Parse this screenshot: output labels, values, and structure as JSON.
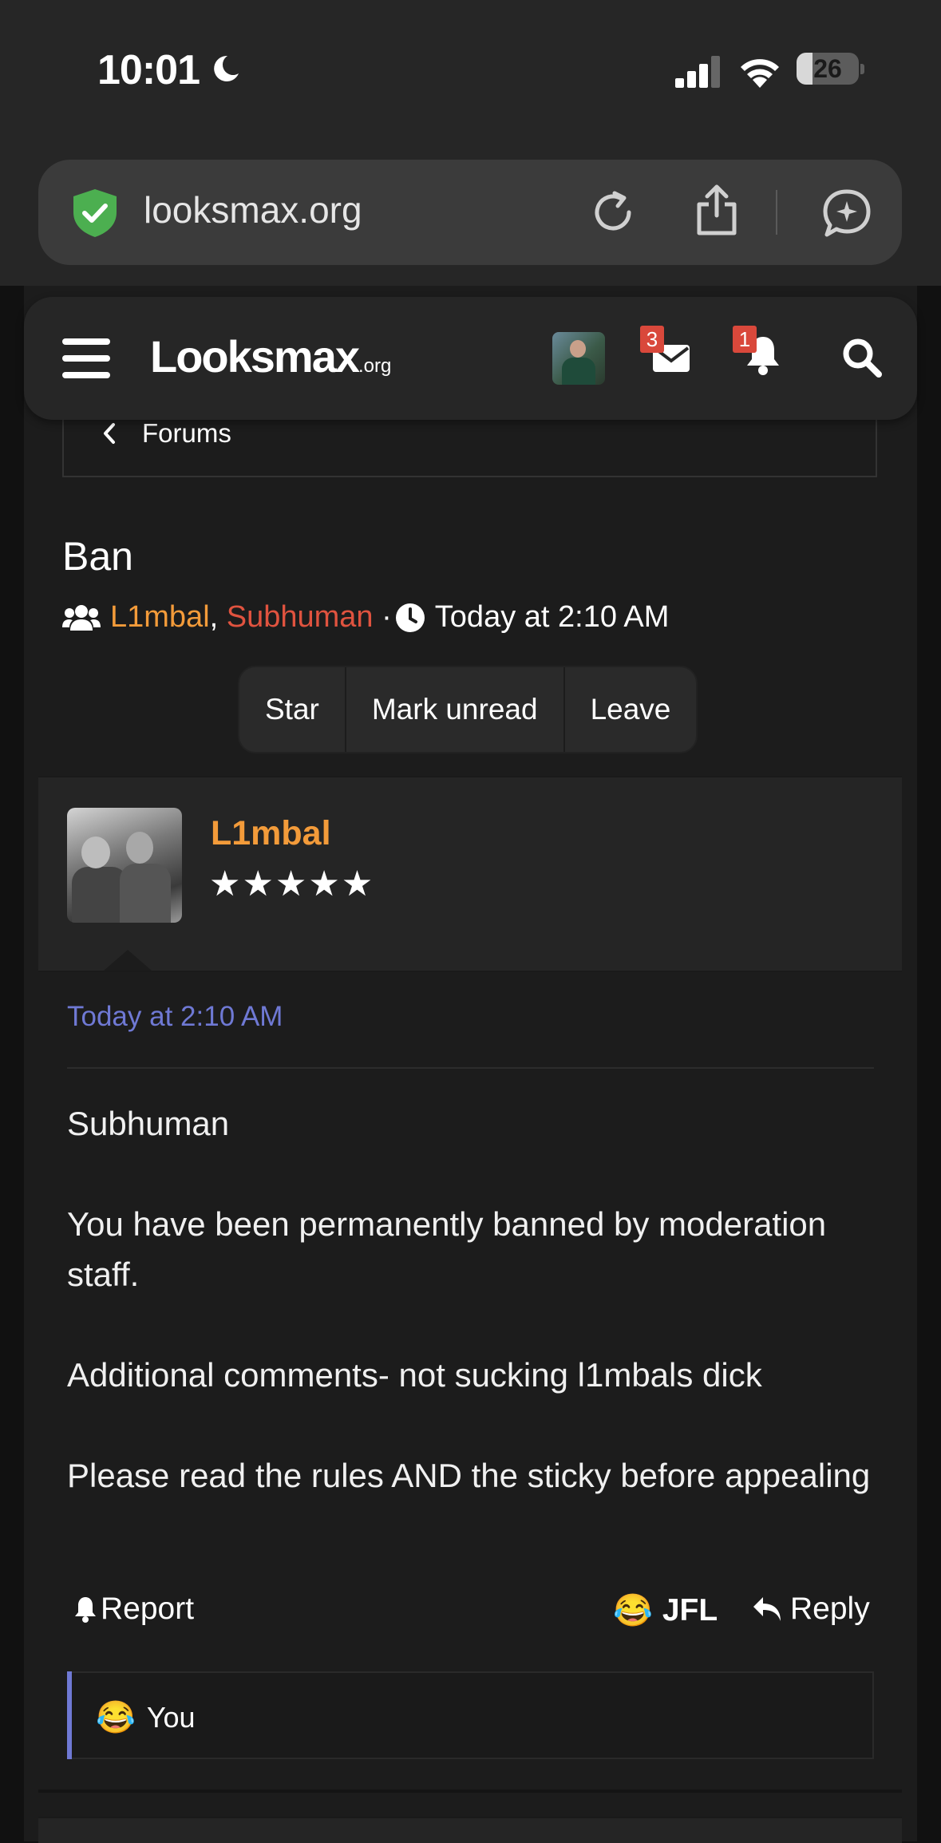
{
  "status_bar": {
    "time": "10:01",
    "battery": "26",
    "battery_level": 0.26
  },
  "browser": {
    "url": "looksmax.org"
  },
  "site": {
    "logo_main": "Looksmax",
    "logo_suffix": ".org",
    "messages_badge": "3",
    "alerts_badge": "1"
  },
  "breadcrumb": {
    "label": "Forums"
  },
  "conversation": {
    "title": "Ban",
    "participant_1": "L1mbal",
    "separator": ",",
    "participant_2": "Subhuman",
    "dot": "·",
    "time": "Today at 2:10 AM",
    "buttons": {
      "star": "Star",
      "mark_unread": "Mark unread",
      "leave": "Leave"
    }
  },
  "message": {
    "username": "L1mbal",
    "stars": "★★★★★",
    "date": "Today at 2:10 AM",
    "paragraphs": [
      "Subhuman",
      "You have been permanently banned by moderation staff.",
      "Additional comments- not sucking l1mbals dick",
      "Please read the rules AND the sticky before appealing"
    ],
    "actions": {
      "report": "Report",
      "reaction_emoji": "😂",
      "reaction": "JFL",
      "reply": "Reply"
    },
    "reactions_bar": {
      "emoji": "😂",
      "text": "You"
    }
  },
  "colors": {
    "accent_orange": "#f39b3a",
    "accent_red": "#e0533f",
    "link_blue": "#6f79d4",
    "badge_red": "#d9483b"
  }
}
